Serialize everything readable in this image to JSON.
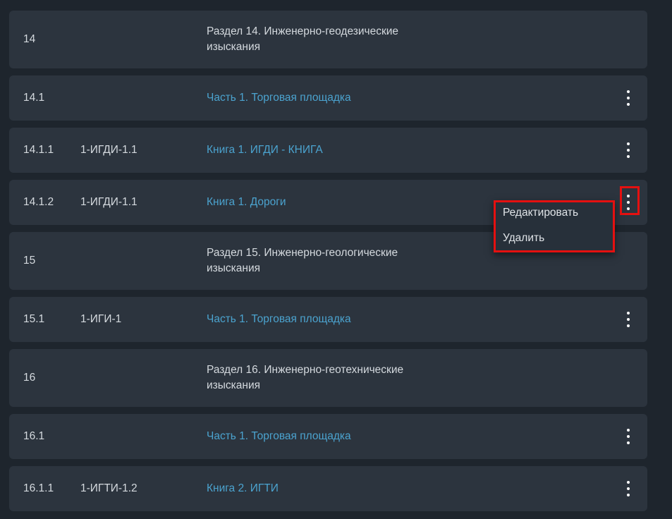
{
  "rows": [
    {
      "num": "14",
      "code": "",
      "title": [
        "Раздел 14. Инженерно-геодезические",
        "изыскания"
      ],
      "type": "section",
      "menu": false
    },
    {
      "num": "14.1",
      "code": "",
      "title": [
        "Часть 1. Торговая площадка"
      ],
      "type": "part",
      "menu": true
    },
    {
      "num": "14.1.1",
      "code": "1-ИГДИ-1.1",
      "title": [
        "Книга 1. ИГДИ - КНИГА"
      ],
      "type": "book",
      "menu": true
    },
    {
      "num": "14.1.2",
      "code": "1-ИГДИ-1.1",
      "title": [
        "Книга 1. Дороги"
      ],
      "type": "book",
      "menu": true
    },
    {
      "num": "15",
      "code": "",
      "title": [
        "Раздел 15. Инженерно-геологические",
        "изыскания"
      ],
      "type": "section",
      "menu": false
    },
    {
      "num": "15.1",
      "code": "1-ИГИ-1",
      "title": [
        "Часть 1. Торговая площадка"
      ],
      "type": "part",
      "menu": true
    },
    {
      "num": "16",
      "code": "",
      "title": [
        "Раздел 16. Инженерно-геотехнические",
        "изыскания"
      ],
      "type": "section",
      "menu": false
    },
    {
      "num": "16.1",
      "code": "",
      "title": [
        "Часть 1. Торговая площадка"
      ],
      "type": "part",
      "menu": true
    },
    {
      "num": "16.1.1",
      "code": "1-ИГТИ-1.2",
      "title": [
        "Книга 2. ИГТИ"
      ],
      "type": "book",
      "menu": true
    }
  ],
  "context_menu": {
    "edit_label": "Редактировать",
    "delete_label": "Удалить"
  },
  "colors": {
    "background": "#1e252d",
    "row": "#2c343e",
    "link": "#4ba3cf",
    "highlight": "#e51010"
  },
  "icons": {
    "row_menu": "more-vertical-icon"
  }
}
